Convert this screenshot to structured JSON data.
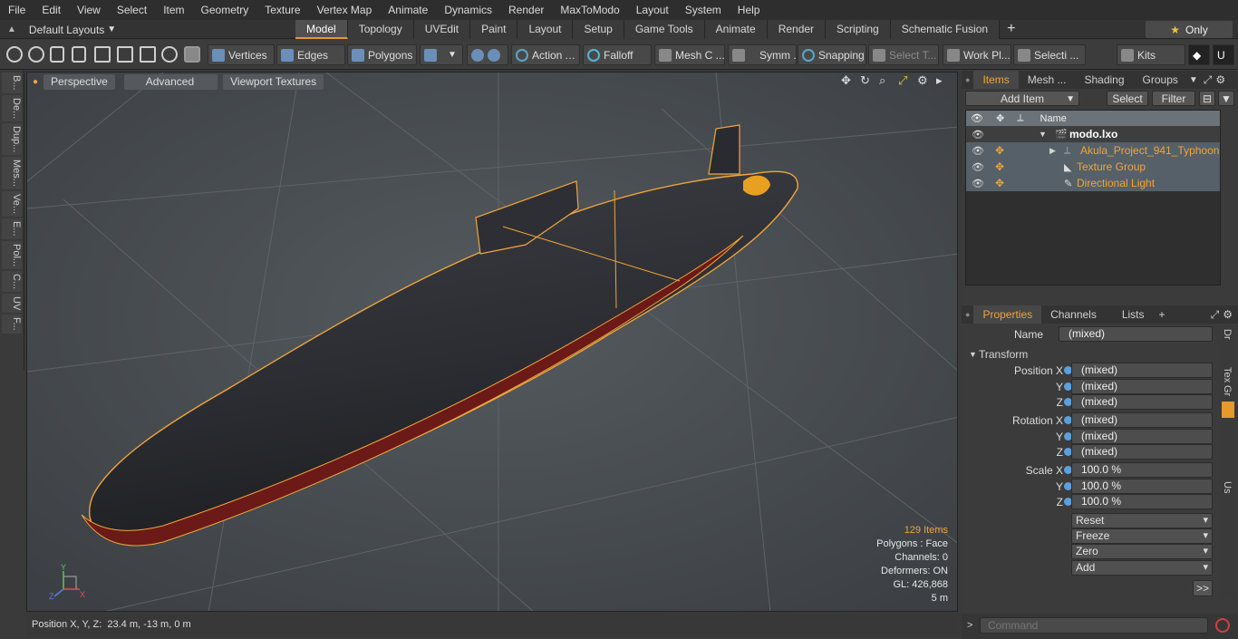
{
  "menu": [
    "File",
    "Edit",
    "View",
    "Select",
    "Item",
    "Geometry",
    "Texture",
    "Vertex Map",
    "Animate",
    "Dynamics",
    "Render",
    "MaxToModo",
    "Layout",
    "System",
    "Help"
  ],
  "layout_select": "Default Layouts",
  "tabs": [
    "Model",
    "Topology",
    "UVEdit",
    "Paint",
    "Layout",
    "Setup",
    "Game Tools",
    "Animate",
    "Render",
    "Scripting",
    "Schematic Fusion"
  ],
  "only_label": "Only",
  "toolbar": {
    "vertices": "Vertices",
    "edges": "Edges",
    "polygons": "Polygons",
    "action": "Action",
    "falloff": "Falloff",
    "mesh": "Mesh C ...",
    "symm": "Symm ...",
    "snapping": "Snapping",
    "select_t": "Select T...",
    "work_pl": "Work Pl...",
    "selecti": "Selecti ...",
    "kits": "Kits"
  },
  "left_tools": [
    "B...",
    "De...",
    "Dup...",
    "Mes...",
    "Ve...",
    "E...",
    "Pol...",
    "C...",
    "UV",
    "F..."
  ],
  "viewport": {
    "perspective": "Perspective",
    "advanced": "Advanced",
    "viewport_textures": "Viewport Textures",
    "items_count": "129 Items",
    "polygons": "Polygons : Face",
    "channels": "Channels: 0",
    "deformers": "Deformers: ON",
    "gl": "GL: 426,868",
    "scale": "5 m",
    "axis_y": "Y",
    "axis_x": "X",
    "axis_z": "Z"
  },
  "status": "Position X, Y, Z:  23.4 m, -13 m, 0 m",
  "items_panel": {
    "tabs": [
      "Items",
      "Mesh ...",
      "Shading",
      "Groups"
    ],
    "add_item": "Add Item",
    "select": "Select",
    "filter": "Filter",
    "name_col": "Name",
    "rows": [
      {
        "name": "modo.lxo"
      },
      {
        "name": "Akula_Project_941_Typhoon"
      },
      {
        "name": "Texture Group"
      },
      {
        "name": "Directional Light"
      }
    ]
  },
  "props_panel": {
    "tabs": [
      "Properties",
      "Channels",
      "Lists"
    ],
    "name_label": "Name",
    "name_value": "(mixed)",
    "transform": "Transform",
    "rows": [
      {
        "label": "Position X",
        "value": "(mixed)"
      },
      {
        "label": "Y",
        "value": "(mixed)"
      },
      {
        "label": "Z",
        "value": "(mixed)"
      },
      {
        "label": "Rotation X",
        "value": "(mixed)"
      },
      {
        "label": "Y",
        "value": "(mixed)"
      },
      {
        "label": "Z",
        "value": "(mixed)"
      },
      {
        "label": "Scale X",
        "value": "100.0 %"
      },
      {
        "label": "Y",
        "value": "100.0 %"
      },
      {
        "label": "Z",
        "value": "100.0 %"
      }
    ],
    "reset": "Reset",
    "freeze": "Freeze",
    "zero": "Zero",
    "add": "Add",
    "more": ">>",
    "side": [
      "Dr",
      "Tex",
      "Gr",
      "Us"
    ]
  },
  "command_placeholder": "Command",
  "colors": {
    "accent": "#f0a53c",
    "selection": "#e59a2a"
  }
}
